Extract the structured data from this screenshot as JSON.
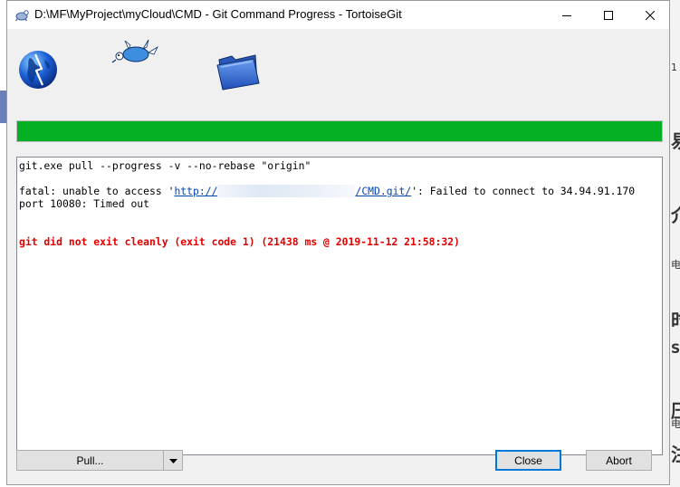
{
  "window": {
    "title": "D:\\MF\\MyProject\\myCloud\\CMD - Git Command Progress - TortoiseGit"
  },
  "controls": {
    "minimize_icon": "minimize-icon",
    "maximize_icon": "maximize-icon",
    "close_icon": "close-icon"
  },
  "progress": {
    "value": 1.0,
    "color": "#06b025"
  },
  "log": {
    "command": "git.exe pull --progress -v --no-rebase \"origin\"",
    "fatal_prefix": "fatal: unable to access '",
    "url_start": "http://",
    "url_end": "/CMD.git/",
    "fatal_suffix": "': Failed to connect to 34.94.91.170",
    "fatal_line2": "port 10080: Timed out",
    "error": "git did not exit cleanly (exit code 1) (21438 ms @ 2019-11-12 21:58:32)",
    "error_color": "#e00000"
  },
  "buttons": {
    "pull": "Pull...",
    "close": "Close",
    "abort": "Abort"
  },
  "background": {
    "glyphs": [
      "1",
      "易",
      "介",
      "电",
      "时",
      "S",
      "压",
      "电",
      "注"
    ]
  }
}
